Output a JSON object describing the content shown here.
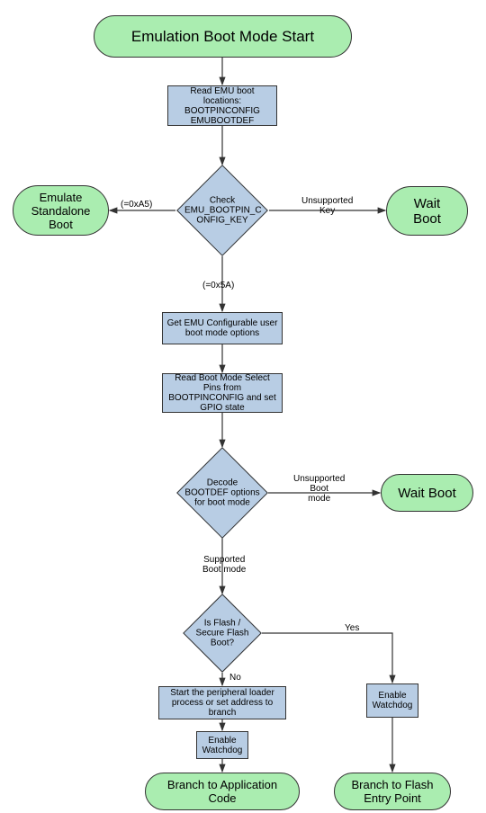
{
  "chart_data": {
    "type": "flowchart",
    "nodes": [
      {
        "id": "start",
        "kind": "terminal",
        "text": "Emulation Boot Mode Start"
      },
      {
        "id": "readEmu",
        "kind": "process",
        "text": "Read EMU boot locations:\nBOOTPINCONFIG\nEMUBOOTDEF"
      },
      {
        "id": "checkKey",
        "kind": "decision",
        "text": "Check EMU_BOOTPIN_CONFIG_KEY"
      },
      {
        "id": "emuStandalone",
        "kind": "terminal",
        "text": "Emulate Standalone Boot"
      },
      {
        "id": "waitBoot1",
        "kind": "terminal",
        "text": "Wait Boot"
      },
      {
        "id": "getEmuOpts",
        "kind": "process",
        "text": "Get EMU Configurable user boot mode options"
      },
      {
        "id": "readPins",
        "kind": "process",
        "text": "Read Boot Mode Select Pins from BOOTPINCONFIG and set GPIO state"
      },
      {
        "id": "decodeBootdef",
        "kind": "decision",
        "text": "Decode BOOTDEF options for boot mode"
      },
      {
        "id": "waitBoot2",
        "kind": "terminal",
        "text": "Wait Boot"
      },
      {
        "id": "isFlash",
        "kind": "decision",
        "text": "Is Flash / Secure Flash Boot?"
      },
      {
        "id": "startLoader",
        "kind": "process",
        "text": "Start the peripheral loader process or set address to branch"
      },
      {
        "id": "enableWd1",
        "kind": "process",
        "text": "Enable Watchdog"
      },
      {
        "id": "enableWd2",
        "kind": "process",
        "text": "Enable Watchdog"
      },
      {
        "id": "branchApp",
        "kind": "terminal",
        "text": "Branch to Application Code"
      },
      {
        "id": "branchFlash",
        "kind": "terminal",
        "text": "Branch to Flash Entry Point"
      }
    ],
    "edges": [
      {
        "from": "start",
        "to": "readEmu"
      },
      {
        "from": "readEmu",
        "to": "checkKey"
      },
      {
        "from": "checkKey",
        "to": "emuStandalone",
        "label": "(=0xA5)"
      },
      {
        "from": "checkKey",
        "to": "waitBoot1",
        "label": "Unsupported Key"
      },
      {
        "from": "checkKey",
        "to": "getEmuOpts",
        "label": "(=0x5A)"
      },
      {
        "from": "getEmuOpts",
        "to": "readPins"
      },
      {
        "from": "readPins",
        "to": "decodeBootdef"
      },
      {
        "from": "decodeBootdef",
        "to": "waitBoot2",
        "label": "Unsupported Boot mode"
      },
      {
        "from": "decodeBootdef",
        "to": "isFlash",
        "label": "Supported Boot mode"
      },
      {
        "from": "isFlash",
        "to": "enableWd2",
        "label": "Yes"
      },
      {
        "from": "isFlash",
        "to": "startLoader",
        "label": "No"
      },
      {
        "from": "startLoader",
        "to": "enableWd1"
      },
      {
        "from": "enableWd1",
        "to": "branchApp"
      },
      {
        "from": "enableWd2",
        "to": "branchFlash"
      }
    ]
  },
  "nodes": {
    "start": "Emulation Boot Mode Start",
    "readEmu_l1": "Read EMU boot locations:",
    "readEmu_l2": "BOOTPINCONFIG",
    "readEmu_l3": "EMUBOOTDEF",
    "checkKey_l1": "Check",
    "checkKey_l2": "EMU_BOOTPIN_C",
    "checkKey_l3": "ONFIG_KEY",
    "emuStandalone_l1": "Emulate",
    "emuStandalone_l2": "Standalone",
    "emuStandalone_l3": "Boot",
    "waitBoot1_l1": "Wait",
    "waitBoot1_l2": "Boot",
    "getEmuOpts": "Get EMU Configurable user boot mode options",
    "readPins": "Read Boot Mode Select Pins from BOOTPINCONFIG and set GPIO state",
    "decodeBootdef_l1": "Decode",
    "decodeBootdef_l2": "BOOTDEF options",
    "decodeBootdef_l3": "for boot mode",
    "waitBoot2": "Wait Boot",
    "isFlash_l1": "Is Flash /",
    "isFlash_l2": "Secure Flash",
    "isFlash_l3": "Boot?",
    "startLoader": "Start the peripheral loader process or set address to branch",
    "enableWd1": "Enable Watchdog",
    "enableWd2": "Enable Watchdog",
    "branchApp_l1": "Branch to Application",
    "branchApp_l2": "Code",
    "branchFlash_l1": "Branch to Flash",
    "branchFlash_l2": "Entry Point"
  },
  "labels": {
    "a5": "(=0xA5)",
    "x5a": "(=0x5A)",
    "unsupKey_l1": "Unsupported",
    "unsupKey_l2": "Key",
    "unsupBoot_l1": "Unsupported",
    "unsupBoot_l2": "Boot",
    "unsupBoot_l3": "mode",
    "supBoot_l1": "Supported",
    "supBoot_l2": "Boot mode",
    "yes": "Yes",
    "no": "No"
  }
}
